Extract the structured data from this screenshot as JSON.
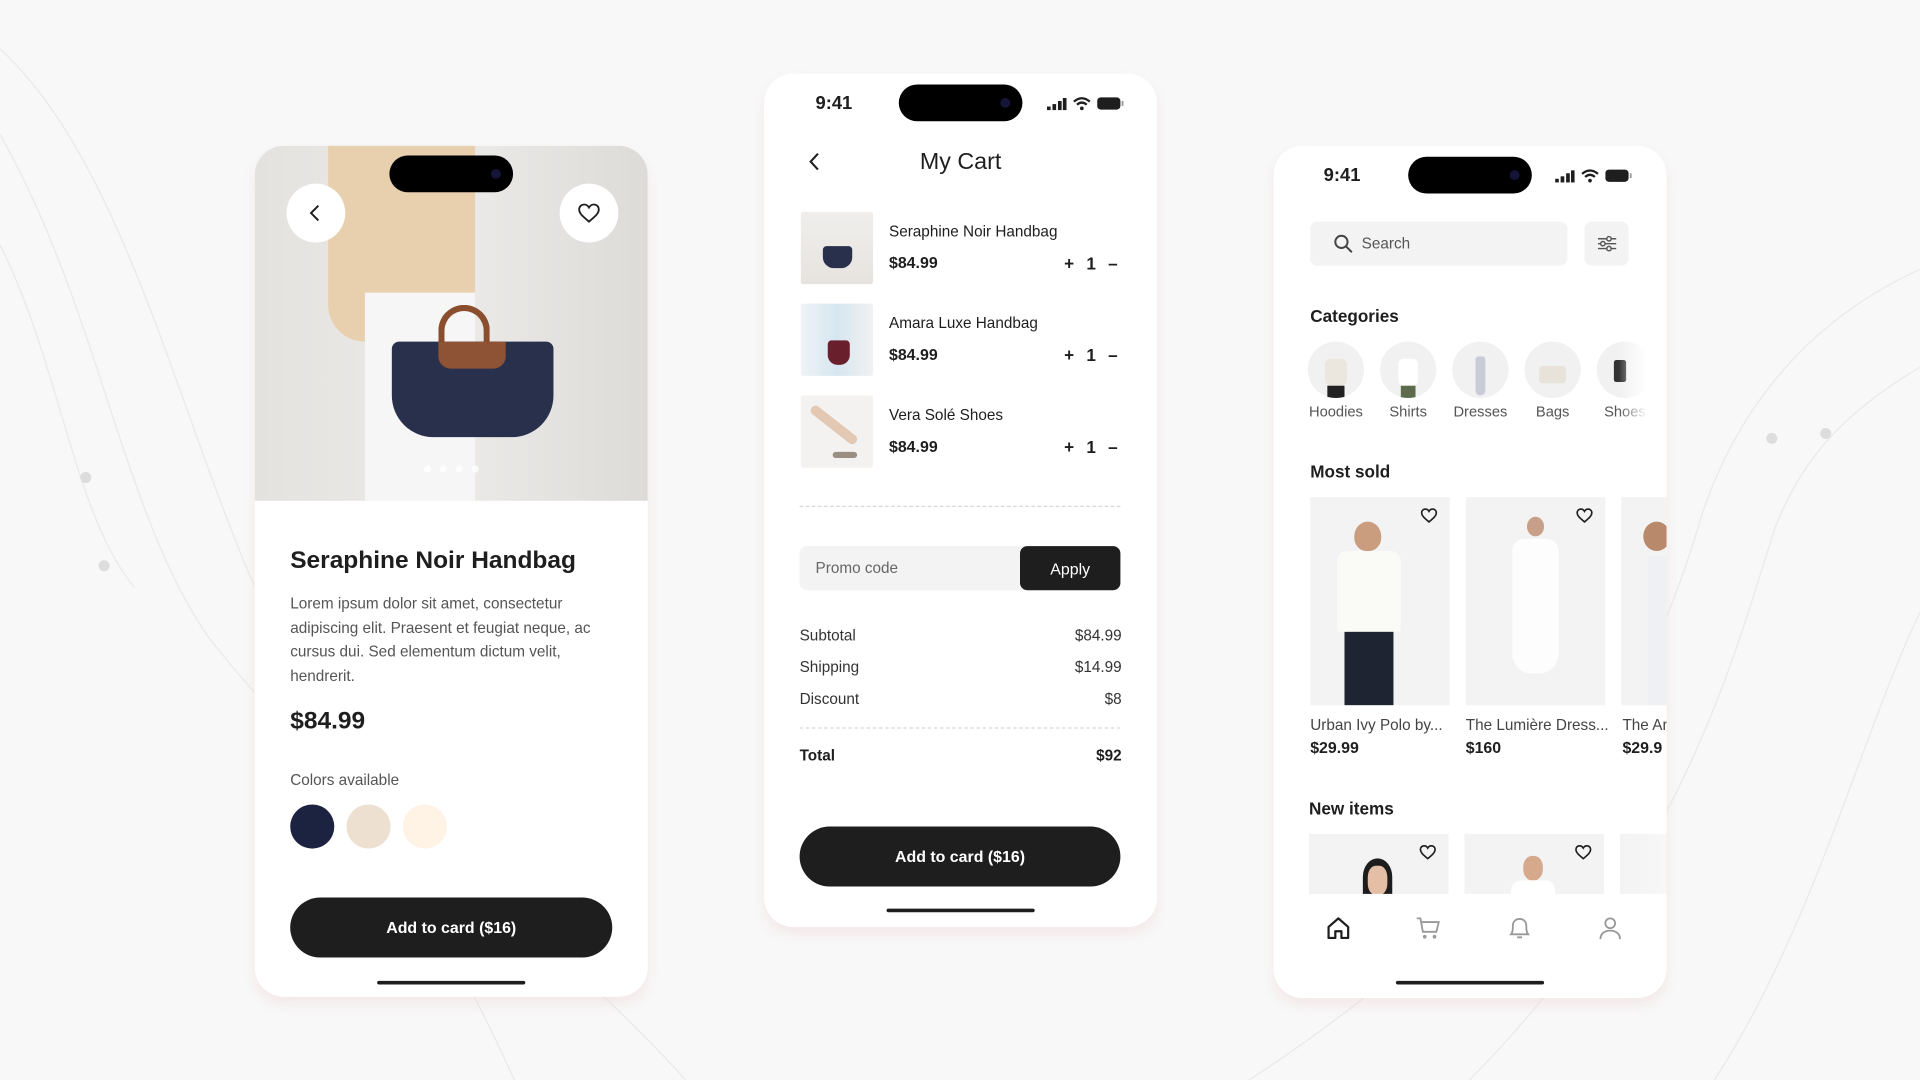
{
  "product": {
    "title": "Seraphine Noir Handbag",
    "description": "Lorem ipsum dolor sit amet, consectetur adipiscing elit. Praesent et feugiat neque, ac cursus dui. Sed elementum dictum velit, hendrerit.",
    "price": "$84.99",
    "colors_label": "Colors available",
    "colors": [
      "#1c2340",
      "#ede0d0",
      "#fff3e6"
    ],
    "image_dots": 4,
    "active_dot": 1,
    "add_button": "Add to card ($16)",
    "icons": {
      "back": "chevron-left-icon",
      "favorite": "heart-icon"
    }
  },
  "cart": {
    "time": "9:41",
    "title": "My Cart",
    "items": [
      {
        "name": "Seraphine Noir Handbag",
        "price": "$84.99",
        "qty": "1"
      },
      {
        "name": "Amara Luxe Handbag",
        "price": "$84.99",
        "qty": "1"
      },
      {
        "name": "Vera Solé Shoes",
        "price": "$84.99",
        "qty": "1"
      }
    ],
    "plus": "+",
    "minus": "–",
    "promo_placeholder": "Promo code",
    "apply": "Apply",
    "subtotal_label": "Subtotal",
    "subtotal": "$84.99",
    "shipping_label": "Shipping",
    "shipping": "$14.99",
    "discount_label": "Discount",
    "discount": "$8",
    "total_label": "Total",
    "total": "$92",
    "add_button": "Add to card ($16)"
  },
  "home": {
    "time": "9:41",
    "search_placeholder": "Search",
    "categories_title": "Categories",
    "categories": [
      "Hoodies",
      "Shirts",
      "Dresses",
      "Bags",
      "Shoes"
    ],
    "most_sold_title": "Most sold",
    "most_sold": [
      {
        "name": "Urban Ivy Polo by...",
        "price": "$29.99"
      },
      {
        "name": "The Lumière Dress...",
        "price": "$160"
      },
      {
        "name": "The Ar",
        "price": "$29.9"
      }
    ],
    "new_items_title": "New items",
    "nav": [
      "home-icon",
      "cart-icon",
      "bell-icon",
      "user-icon"
    ]
  }
}
